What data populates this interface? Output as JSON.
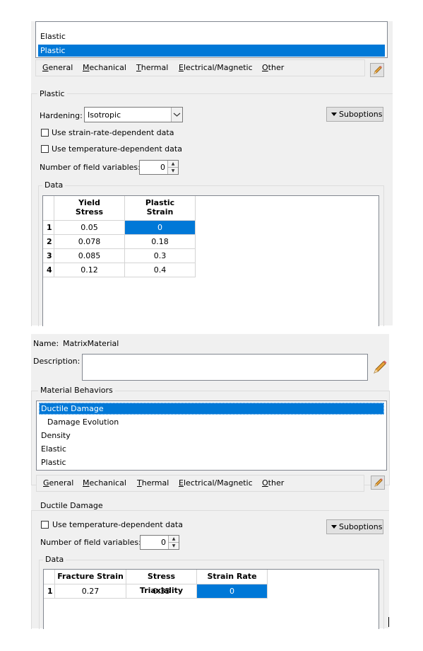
{
  "top": {
    "behaviors": [
      "Elastic",
      "Plastic"
    ],
    "tabs": [
      "General",
      "Mechanical",
      "Thermal",
      "Electrical/Magnetic",
      "Other"
    ],
    "section_title": "Plastic",
    "hardening_label": "Hardening:",
    "hardening_value": "Isotropic",
    "suboptions_label": "Suboptions",
    "strain_rate_label": "Use strain-rate-dependent data",
    "temp_label": "Use temperature-dependent data",
    "field_vars_label": "Number of field variables:",
    "field_vars_value": "0",
    "data_title": "Data",
    "table": {
      "columns": [
        [
          "Yield",
          "Stress"
        ],
        [
          "Plastic",
          "Strain"
        ]
      ],
      "rows": [
        {
          "n": "1",
          "cells": [
            "0.05",
            "0"
          ]
        },
        {
          "n": "2",
          "cells": [
            "0.078",
            "0.18"
          ]
        },
        {
          "n": "3",
          "cells": [
            "0.085",
            "0.3"
          ]
        },
        {
          "n": "4",
          "cells": [
            "0.12",
            "0.4"
          ]
        }
      ]
    }
  },
  "bottom": {
    "name_label": "Name:",
    "name_value": "MatrixMaterial",
    "description_label": "Description:",
    "behaviors_title": "Material Behaviors",
    "behaviors": [
      "Ductile Damage",
      "Damage Evolution",
      "Density",
      "Elastic",
      "Plastic"
    ],
    "tabs": [
      "General",
      "Mechanical",
      "Thermal",
      "Electrical/Magnetic",
      "Other"
    ],
    "section_title": "Ductile Damage",
    "temp_label": "Use temperature-dependent data",
    "suboptions_label": "Suboptions",
    "field_vars_label": "Number of field variables:",
    "field_vars_value": "0",
    "data_title": "Data",
    "table": {
      "columns": [
        "Fracture Strain",
        "Stress Triaxiality",
        "Strain Rate"
      ],
      "rows": [
        {
          "n": "1",
          "cells": [
            "0.27",
            "0.33",
            "0"
          ]
        }
      ]
    }
  },
  "colors": {
    "selection": "#0078d7",
    "panel": "#f0f0f0"
  },
  "icons": {
    "edit": "pencil-icon",
    "dropdown": "chevron-down-icon",
    "menu": "triangle-down-icon"
  }
}
